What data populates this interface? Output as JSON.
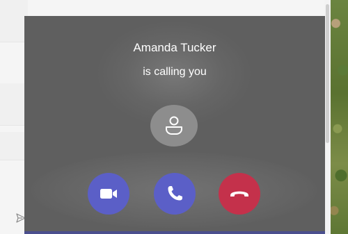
{
  "call": {
    "caller_name": "Amanda Tucker",
    "subtitle": "is calling you"
  },
  "actions": {
    "video_accept": {
      "icon": "video-camera-icon",
      "color": "#5b5fc7"
    },
    "audio_accept": {
      "icon": "phone-icon",
      "color": "#5b5fc7"
    },
    "decline": {
      "icon": "hang-up-icon",
      "color": "#c4314b"
    }
  },
  "avatar": {
    "icon": "person-icon",
    "color": "#8d8d8d"
  },
  "colors": {
    "window_background": "#5f5f5f",
    "accent": "#5b5fc7",
    "decline": "#c4314b"
  }
}
